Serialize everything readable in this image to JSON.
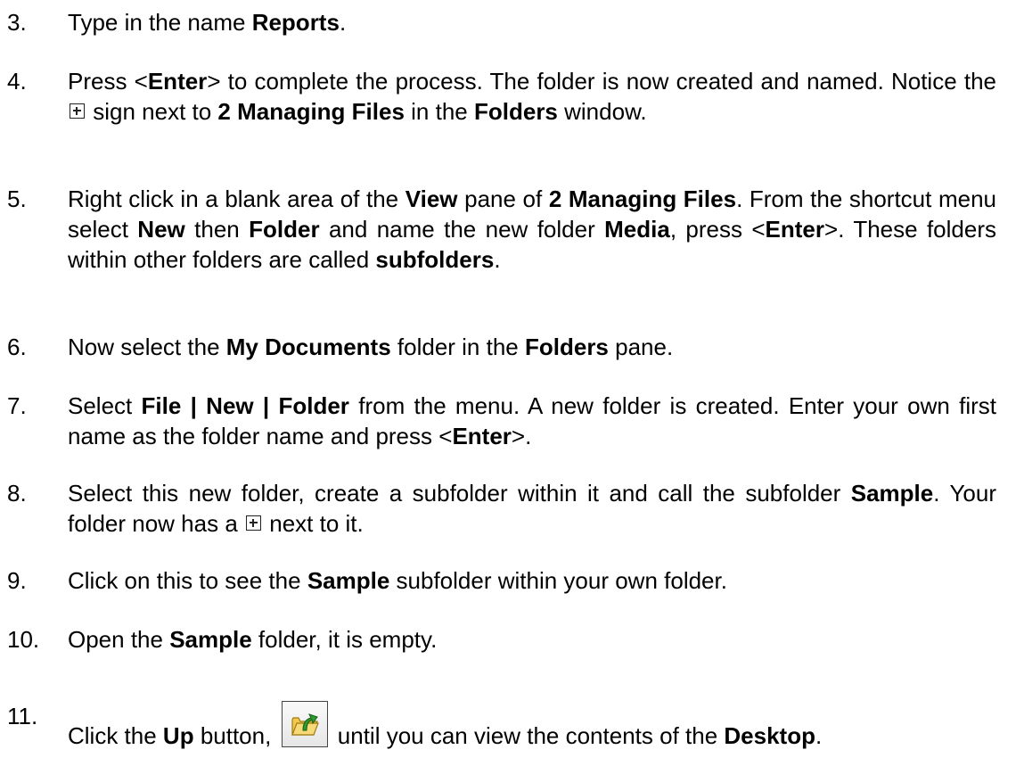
{
  "steps": [
    {
      "num": "3.",
      "t": [
        "Type in the name ",
        "Reports",
        "."
      ]
    },
    {
      "num": "4.",
      "t": [
        "Press <",
        "Enter",
        "> to complete the process. The folder is now created and named. Notice the ",
        " sign next to ",
        "2 Managing Files",
        " in the ",
        "Folders",
        " window."
      ]
    },
    {
      "num": "5.",
      "t": [
        "Right click in a blank area of the ",
        "View",
        " pane of ",
        "2 Managing Files",
        ". From the shortcut menu select ",
        "New",
        " then ",
        "Folder",
        " and name the new folder ",
        "Media",
        ", press <",
        "Enter",
        ">. These folders within other folders are called ",
        "subfolders",
        "."
      ]
    },
    {
      "num": "6.",
      "t": [
        "Now select the ",
        "My Documents",
        " folder in the ",
        "Folders",
        " pane."
      ]
    },
    {
      "num": "7.",
      "t": [
        "Select ",
        "File | New | Folder",
        " from the menu. A new folder is created. Enter your own first name as the folder name and press <",
        "Enter",
        ">."
      ]
    },
    {
      "num": "8.",
      "t": [
        "Select this new folder, create a subfolder within it and call the subfolder ",
        "Sample",
        ". Your folder now has a ",
        " next to it."
      ]
    },
    {
      "num": "9.",
      "t": [
        "Click on this to see the ",
        "Sample",
        " subfolder within your own folder."
      ]
    },
    {
      "num": "10.",
      "t": [
        "Open the ",
        "Sample",
        " folder, it is empty."
      ]
    },
    {
      "num": "11.",
      "t": [
        "Click the ",
        "Up",
        " button, ",
        " until you can view the contents of the ",
        "Desktop",
        "."
      ]
    }
  ],
  "icons": {
    "expand": "plus-box-icon",
    "up": "up-folder-icon"
  },
  "colors": {
    "up_arrow": "#2e9b2e",
    "folder": "#f2c94c"
  }
}
